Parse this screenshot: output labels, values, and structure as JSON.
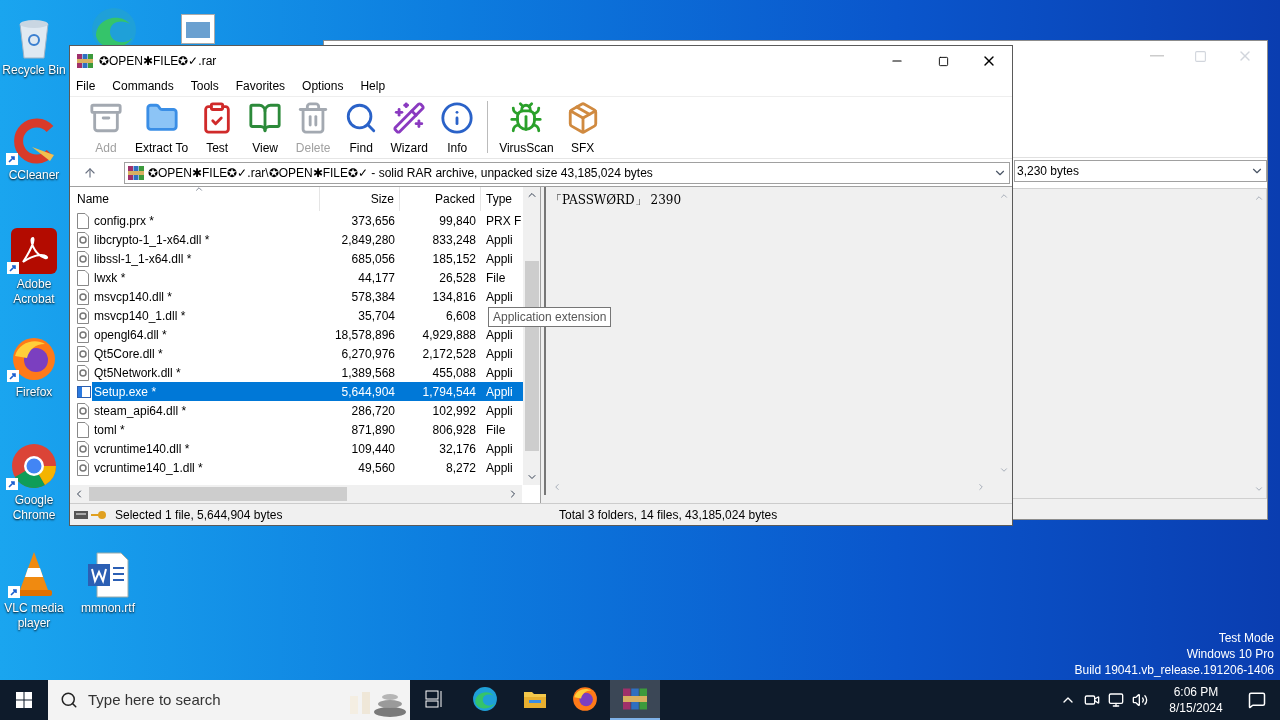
{
  "desktop_icons": [
    {
      "kind": "recycle",
      "label": "Recycle Bin",
      "shortcut": false
    },
    {
      "kind": "ccleaner",
      "label": "CCleaner",
      "shortcut": true
    },
    {
      "kind": "acrobat",
      "label": "Adobe Acrobat",
      "shortcut": true
    },
    {
      "kind": "firefox",
      "label": "Firefox",
      "shortcut": true
    },
    {
      "kind": "chrome",
      "label": "Google Chrome",
      "shortcut": true
    },
    {
      "kind": "vlc",
      "label": "VLC media player",
      "shortcut": true
    },
    {
      "kind": "edge",
      "shortcut": false
    },
    {
      "kind": "image",
      "shortcut": false
    },
    {
      "kind": "word",
      "label": "mmnon.rtf",
      "shortcut": false
    }
  ],
  "back_window": {
    "address": "3,230 bytes"
  },
  "winrar": {
    "title": "✪OPEN✱FILE✪✓.rar",
    "menu": [
      "File",
      "Commands",
      "Tools",
      "Favorites",
      "Options",
      "Help"
    ],
    "toolbar": [
      {
        "kind": "add",
        "label": "Add",
        "disabled": true
      },
      {
        "kind": "extract",
        "label": "Extract To",
        "disabled": false
      },
      {
        "kind": "test",
        "label": "Test",
        "disabled": false
      },
      {
        "kind": "view",
        "label": "View",
        "disabled": false
      },
      {
        "kind": "delete",
        "label": "Delete",
        "disabled": true
      },
      {
        "kind": "find",
        "label": "Find",
        "disabled": false
      },
      {
        "kind": "wizard",
        "label": "Wizard",
        "disabled": false
      },
      {
        "kind": "info",
        "label": "Info",
        "disabled": false
      },
      {
        "kind": "virusscan",
        "label": "VirusScan",
        "disabled": false
      },
      {
        "kind": "sfx",
        "label": "SFX",
        "disabled": false
      }
    ],
    "address": "✪OPEN✱FILE✪✓.rar\\✪OPEN✱FILE✪✓ - solid RAR archive, unpacked size 43,185,024 bytes",
    "columns": [
      "Name",
      "Size",
      "Packed",
      "Type"
    ],
    "rows": [
      {
        "kind": "file",
        "name": "config.prx *",
        "size": "373,656",
        "packed": "99,840",
        "type": "PRX F",
        "selected": false
      },
      {
        "kind": "dll",
        "name": "libcrypto-1_1-x64.dll *",
        "size": "2,849,280",
        "packed": "833,248",
        "type": "Appli",
        "selected": false
      },
      {
        "kind": "dll",
        "name": "libssl-1_1-x64.dll *",
        "size": "685,056",
        "packed": "185,152",
        "type": "Appli",
        "selected": false
      },
      {
        "kind": "file",
        "name": "lwxk *",
        "size": "44,177",
        "packed": "26,528",
        "type": "File",
        "selected": false
      },
      {
        "kind": "dll",
        "name": "msvcp140.dll *",
        "size": "578,384",
        "packed": "134,816",
        "type": "Appli",
        "selected": false
      },
      {
        "kind": "dll",
        "name": "msvcp140_1.dll *",
        "size": "35,704",
        "packed": "6,608",
        "selected": false
      },
      {
        "kind": "dll",
        "name": "opengl64.dll *",
        "size": "18,578,896",
        "packed": "4,929,888",
        "type": "Appli",
        "selected": false
      },
      {
        "kind": "dll",
        "name": "Qt5Core.dll *",
        "size": "6,270,976",
        "packed": "2,172,528",
        "type": "Appli",
        "selected": false
      },
      {
        "kind": "dll",
        "name": "Qt5Network.dll *",
        "size": "1,389,568",
        "packed": "455,088",
        "type": "Appli",
        "selected": false
      },
      {
        "kind": "exe",
        "name": "Setup.exe *",
        "size": "5,644,904",
        "packed": "1,794,544",
        "type": "Appli",
        "selected": true
      },
      {
        "kind": "dll",
        "name": "steam_api64.dll *",
        "size": "286,720",
        "packed": "102,992",
        "type": "Appli",
        "selected": false
      },
      {
        "kind": "file",
        "name": "toml *",
        "size": "871,890",
        "packed": "806,928",
        "type": "File",
        "selected": false
      },
      {
        "kind": "dll",
        "name": "vcruntime140.dll *",
        "size": "109,440",
        "packed": "32,176",
        "type": "Appli",
        "selected": false
      },
      {
        "kind": "dll",
        "name": "vcruntime140_1.dll *",
        "size": "49,560",
        "packed": "8,272",
        "type": "Appli",
        "selected": false
      }
    ],
    "tooltip": "Application extension",
    "comment": "「PASSWØRD」 2390",
    "status_left": "Selected 1 file, 5,644,904 bytes",
    "status_right": "Total 3 folders, 14 files, 43,185,024 bytes"
  },
  "os_info": [
    "Test Mode",
    "Windows 10 Pro",
    "Build 19041.vb_release.191206-1406"
  ],
  "taskbar": {
    "search_placeholder": "Type here to search",
    "apps": [
      {
        "kind": "taskview",
        "selected": false
      },
      {
        "kind": "edge",
        "selected": false
      },
      {
        "kind": "explorer",
        "selected": false
      },
      {
        "kind": "firefox",
        "selected": false
      },
      {
        "kind": "winrar",
        "selected": true
      }
    ],
    "time": "6:06 PM",
    "date": "8/15/2024"
  }
}
